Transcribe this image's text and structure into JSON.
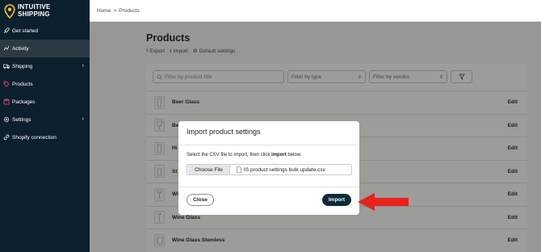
{
  "brand": {
    "line1": "INTUITIVE",
    "line2": "SHIPPING",
    "accent": "#f5c518",
    "sidebar_bg": "#0c1f2c"
  },
  "sidebar": {
    "items": [
      {
        "label": "Get started",
        "icon": "rocket-icon"
      },
      {
        "label": "Activity",
        "icon": "activity-icon",
        "active": true
      },
      {
        "label": "Shipping",
        "icon": "truck-icon",
        "has_submenu": true
      },
      {
        "label": "Products",
        "icon": "tag-icon"
      },
      {
        "label": "Packages",
        "icon": "box-icon"
      },
      {
        "label": "Settings",
        "icon": "gear-icon",
        "has_submenu": true
      },
      {
        "label": "Shopify connection",
        "icon": "link-icon"
      }
    ]
  },
  "breadcrumb": {
    "home": "Home",
    "separator": ">",
    "current": "Products"
  },
  "page": {
    "title": "Products",
    "actions": [
      {
        "label": "Export",
        "icon": "export-icon"
      },
      {
        "label": "Import",
        "icon": "import-icon"
      },
      {
        "label": "Default settings",
        "icon": "gear-icon"
      }
    ]
  },
  "filters": {
    "search_placeholder": "Filter by product title",
    "type_placeholder": "Filter by type",
    "vendor_placeholder": "Filter by vendor"
  },
  "products": [
    {
      "name": "Beer Glass",
      "edit": "Edit"
    },
    {
      "name": "Be",
      "edit": "Edit"
    },
    {
      "name": "Hi",
      "edit": "Edit"
    },
    {
      "name": "St",
      "edit": "Edit"
    },
    {
      "name": "Wi",
      "edit": "Edit"
    },
    {
      "name": "Wine Glass",
      "edit": "Edit"
    },
    {
      "name": "Wine Glass Stemless",
      "edit": "Edit"
    }
  ],
  "modal": {
    "title": "Import product settings",
    "instruction_prefix": "Select the CSV file to import, then click ",
    "instruction_bold": "import",
    "instruction_suffix": " below.",
    "choose_file_label": "Choose File",
    "file_name": "IS product settings bulk update.csv",
    "close_label": "Close",
    "import_label": "Import",
    "import_color": "#0c2b38"
  },
  "annotation": {
    "arrow_color": "#e8221c"
  }
}
